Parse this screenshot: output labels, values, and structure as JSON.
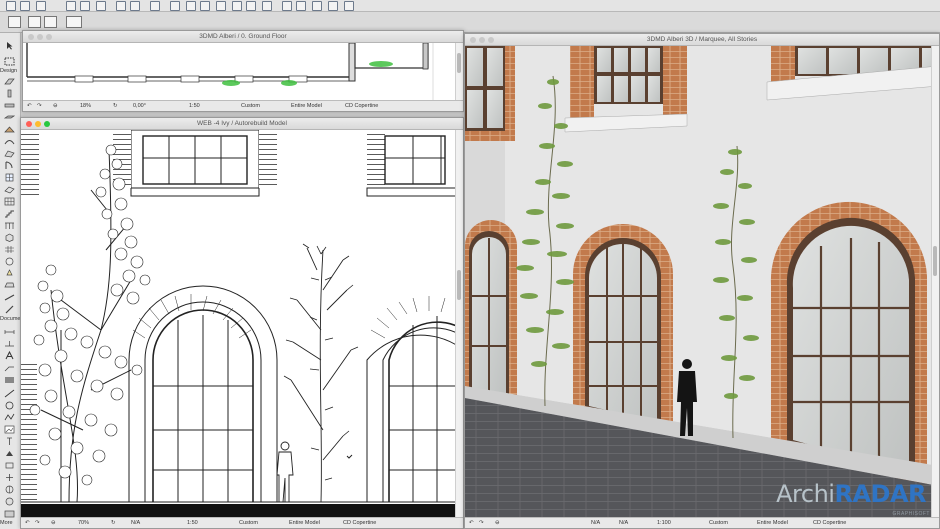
{
  "toolbox": {
    "design_label": "Design",
    "document_label": "Docume",
    "more_label": "More"
  },
  "plan_window": {
    "title": "3DMD Alberi / 0. Ground Floor",
    "status": {
      "zoom": "18%",
      "angle": "0,00°",
      "scale": "1:50",
      "layers": "Custom",
      "model": "Entire Model",
      "set": "CD Copertine"
    }
  },
  "elevation_window": {
    "title": "WEB -4 Ivy / Autorebuild Model",
    "status": {
      "zoom": "70%",
      "angle": "N/A",
      "scale": "1:50",
      "layers": "Custom",
      "model": "Entire Model",
      "set": "CD Copertine"
    }
  },
  "view3d_window": {
    "title": "3DMD Alberi 3D / Marquee, All Stories",
    "status": {
      "zoom": "N/A",
      "angle": "N/A",
      "scale": "1:100",
      "layers": "Custom",
      "model": "Entire Model",
      "set": "CD Copertine"
    }
  },
  "watermark": {
    "prefix": "Archi",
    "suffix": "RADAR",
    "sub": "GRAPHISOFT"
  },
  "colors": {
    "brick": "#b9764a",
    "window_frame": "#6b4630",
    "wall": "#e9e9e9",
    "pavement": "#56565a",
    "accent_blue": "#2f74c4"
  },
  "icons": {
    "close": "close-icon",
    "minimize": "minimize-icon",
    "zoom": "zoom-icon"
  }
}
